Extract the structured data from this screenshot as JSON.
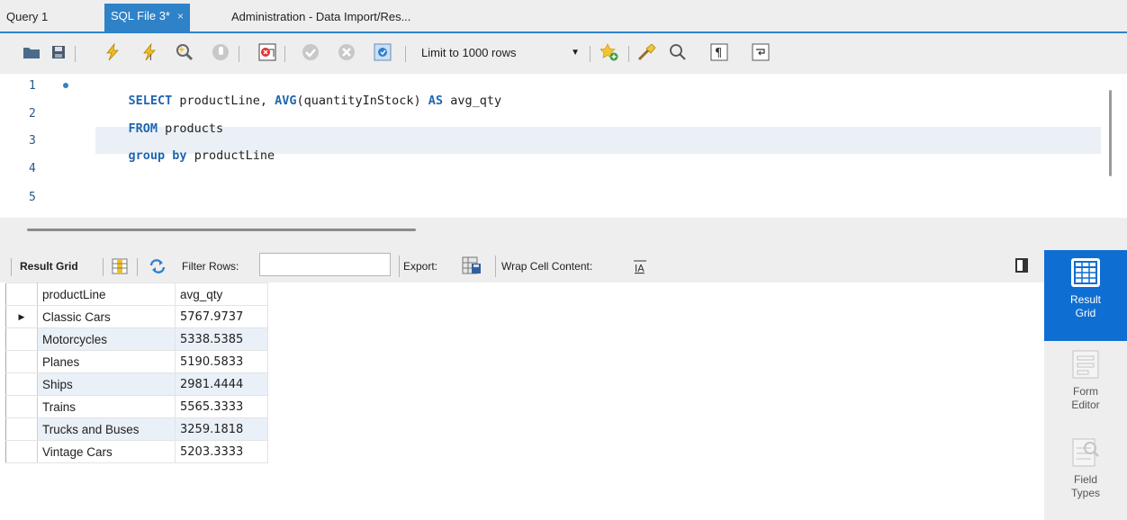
{
  "tabs": [
    {
      "label": "Query 1",
      "active": false
    },
    {
      "label": "SQL File 3*",
      "active": true,
      "close": "×"
    },
    {
      "label": "Administration - Data Import/Res...",
      "active": false
    }
  ],
  "toolbar": {
    "limit_label": "Limit to 1000 rows",
    "icons": [
      "open-folder-icon",
      "save-icon",
      "execute-icon",
      "execute-current-icon",
      "explain-icon",
      "stop-icon",
      "toggle-error-icon",
      "commit-icon",
      "rollback-icon",
      "autocommit-icon",
      "limit-dropdown",
      "add-snippet-icon",
      "beautify-icon",
      "find-icon",
      "invisible-chars-icon",
      "wrap-icon"
    ]
  },
  "editor": {
    "line_numbers": [
      "1",
      "2",
      "3",
      "4",
      "5"
    ],
    "lines": [
      [
        {
          "t": "SELECT",
          "kw": true
        },
        {
          "t": " productLine, ",
          "kw": false
        },
        {
          "t": "AVG",
          "kw": true
        },
        {
          "t": "(quantityInStock) ",
          "kw": false
        },
        {
          "t": "AS",
          "kw": true
        },
        {
          "t": " avg_qty",
          "kw": false
        }
      ],
      [
        {
          "t": "FROM",
          "kw": true
        },
        {
          "t": " products",
          "kw": false
        }
      ],
      [
        {
          "t": "group",
          "kw": true
        },
        {
          "t": " ",
          "kw": false
        },
        {
          "t": "by",
          "kw": true
        },
        {
          "t": " productLine",
          "kw": false
        }
      ],
      [],
      []
    ]
  },
  "result_toolbar": {
    "result_grid_label": "Result Grid",
    "filter_label": "Filter Rows:",
    "filter_value": "",
    "export_label": "Export:",
    "wrap_label": "Wrap Cell Content:"
  },
  "grid": {
    "columns": [
      "productLine",
      "avg_qty"
    ],
    "rows": [
      [
        "Classic Cars",
        "5767.9737"
      ],
      [
        "Motorcycles",
        "5338.5385"
      ],
      [
        "Planes",
        "5190.5833"
      ],
      [
        "Ships",
        "2981.4444"
      ],
      [
        "Trains",
        "5565.3333"
      ],
      [
        "Trucks and Buses",
        "3259.1818"
      ],
      [
        "Vintage Cars",
        "5203.3333"
      ]
    ],
    "selected_row_marker": "▶"
  },
  "side_panel": {
    "items": [
      {
        "label1": "Result",
        "label2": "Grid",
        "active": true
      },
      {
        "label1": "Form",
        "label2": "Editor",
        "active": false
      },
      {
        "label1": "Field",
        "label2": "Types",
        "active": false
      }
    ]
  },
  "colors": {
    "accent": "#2f82c8",
    "panel_active": "#0f6ed1",
    "keyword": "#1f66b0",
    "alt_row": "#eaf0f8"
  }
}
